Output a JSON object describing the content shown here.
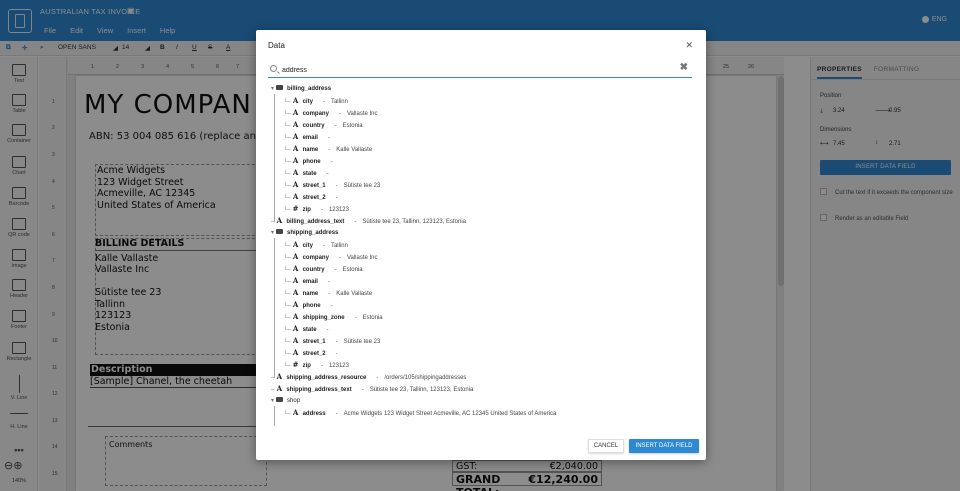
{
  "topbar": {
    "doc_title": "AUSTRALIAN TAX INVOICE",
    "menu": [
      "File",
      "Edit",
      "View",
      "Insert",
      "Help"
    ],
    "lang": "ENG"
  },
  "toolbar": {
    "font": "OPEN SANS",
    "size": "14",
    "bold": "B",
    "italic": "I",
    "underline": "U",
    "strike": "S",
    "color": "A"
  },
  "tools": [
    "Text",
    "Table",
    "Container",
    "Chart",
    "Barcode",
    "QR code",
    "Image",
    "Header",
    "Footer",
    "Rectangle",
    "V. Line",
    "H. Line"
  ],
  "zoom": "140%",
  "row_numbers": [
    "1",
    "2",
    "3",
    "4",
    "5",
    "6",
    "7",
    "8",
    "9",
    "10",
    "11",
    "12",
    "13",
    "14",
    "15"
  ],
  "ruler": [
    "1",
    "2",
    "3",
    "4",
    "5",
    "6",
    "7",
    "25",
    "26"
  ],
  "document": {
    "company": "MY COMPAN",
    "abn": "ABN: 53 004 085 616 (replace and sa",
    "address_lines": [
      "Acme Widgets",
      "123 Widget Street",
      "Acmeville, AC 12345",
      "United States of America"
    ],
    "billing_heading": "BILLING DETAILS",
    "billing_lines": [
      "Kalle Vallaste",
      "Vallaste Inc",
      "",
      "Sütiste tee 23",
      "Tallinn",
      "123123",
      "Estonia"
    ],
    "description_heading": "Description",
    "sample_row": "[Sample] Chanel, the cheetah",
    "comments": "Comments",
    "gst_label": "GST:",
    "gst_value": "€2,040.00",
    "grand_total_label": "GRAND TOTAL:",
    "grand_total_value": "€12,240.00"
  },
  "properties": {
    "tabs": [
      "PROPERTIES",
      "FORMATTING"
    ],
    "position_label": "Position",
    "pos_x": "3.24",
    "pos_y": "0.95",
    "dimensions_label": "Dimensions",
    "width": "7.45",
    "height": "2.71",
    "insert_button": "INSERT DATA FIELD",
    "check_cut": "Cut the text if it exceeds the component size",
    "check_editable": "Render as an editable Field"
  },
  "modal": {
    "title": "Data",
    "search_value": "address",
    "cancel_label": "CANCEL",
    "insert_label": "INSERT DATA FIELD",
    "tree": [
      {
        "kind": "folder",
        "key": "billing_address",
        "val": "",
        "depth": 0
      },
      {
        "kind": "text",
        "key": "city",
        "val": "Tallinn",
        "depth": 1
      },
      {
        "kind": "text",
        "key": "company",
        "val": "Vallaste Inc",
        "depth": 1
      },
      {
        "kind": "text",
        "key": "country",
        "val": "Estonia",
        "depth": 1
      },
      {
        "kind": "text",
        "key": "email",
        "val": "",
        "depth": 1
      },
      {
        "kind": "text",
        "key": "name",
        "val": "Kalle Vallaste",
        "depth": 1
      },
      {
        "kind": "text",
        "key": "phone",
        "val": "",
        "depth": 1
      },
      {
        "kind": "text",
        "key": "state",
        "val": "",
        "depth": 1
      },
      {
        "kind": "text",
        "key": "street_1",
        "val": "Sütiste tee 23",
        "depth": 1
      },
      {
        "kind": "text",
        "key": "street_2",
        "val": "",
        "depth": 1
      },
      {
        "kind": "number",
        "key": "zip",
        "val": "123123",
        "depth": 1
      },
      {
        "kind": "text",
        "key": "billing_address_text",
        "val": "Sütiste tee 23, Tallinn, 123123, Estonia",
        "depth": 0
      },
      {
        "kind": "folder",
        "key": "shipping_address",
        "val": "",
        "depth": 0
      },
      {
        "kind": "text",
        "key": "city",
        "val": "Tallinn",
        "depth": 1
      },
      {
        "kind": "text",
        "key": "company",
        "val": "Vallaste Inc",
        "depth": 1
      },
      {
        "kind": "text",
        "key": "country",
        "val": "Estonia",
        "depth": 1
      },
      {
        "kind": "text",
        "key": "email",
        "val": "",
        "depth": 1
      },
      {
        "kind": "text",
        "key": "name",
        "val": "Kalle Vallaste",
        "depth": 1
      },
      {
        "kind": "text",
        "key": "phone",
        "val": "",
        "depth": 1
      },
      {
        "kind": "text",
        "key": "shipping_zone",
        "val": "Estonia",
        "depth": 1
      },
      {
        "kind": "text",
        "key": "state",
        "val": "",
        "depth": 1
      },
      {
        "kind": "text",
        "key": "street_1",
        "val": "Sütiste tee 23",
        "depth": 1
      },
      {
        "kind": "text",
        "key": "street_2",
        "val": "",
        "depth": 1
      },
      {
        "kind": "number",
        "key": "zip",
        "val": "123123",
        "depth": 1
      },
      {
        "kind": "text",
        "key": "shipping_address_resource",
        "val": "/orders/105/shippingaddresses",
        "depth": 0
      },
      {
        "kind": "text",
        "key": "shipping_address_text",
        "val": "Sütiste tee 23, Tallinn, 123123, Estonia",
        "depth": 0
      },
      {
        "kind": "folder",
        "key": "shop",
        "val": "",
        "depth": 0,
        "plain": true
      },
      {
        "kind": "text",
        "key": "address",
        "val": "Acme Widgets 123 Widget Street Acmeville, AC 12345 United States of America",
        "depth": 1
      }
    ]
  }
}
